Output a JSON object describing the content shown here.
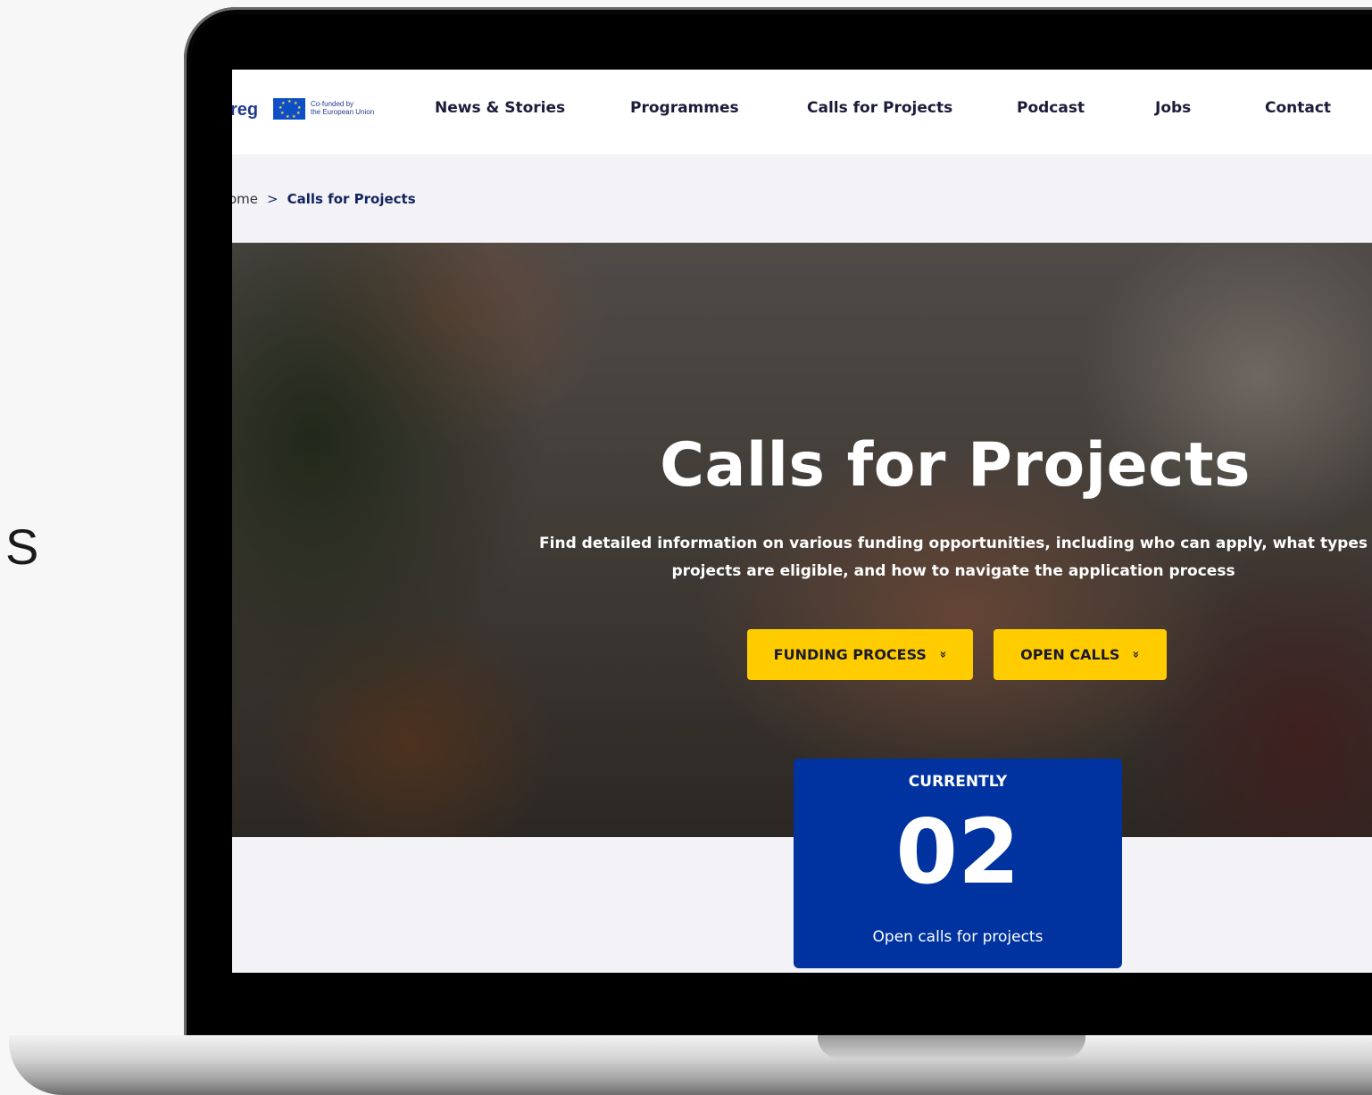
{
  "side_text": "S",
  "nav": {
    "logo_text": "reg",
    "eu_caption_line1": "Co-funded by",
    "eu_caption_line2": "the European Union",
    "items": [
      "News & Stories",
      "Programmes",
      "Calls for Projects",
      "Podcast",
      "Jobs",
      "Contact"
    ]
  },
  "breadcrumb": {
    "home": "ome",
    "separator": ">",
    "current": "Calls for Projects"
  },
  "hero": {
    "title": "Calls for Projects",
    "subtitle_line1": "Find detailed information on various funding opportunities, including who can apply, what types",
    "subtitle_line2": "projects are eligible, and how to navigate the application process",
    "buttons": [
      {
        "label": "FUNDING PROCESS",
        "icon": "double-chevron-down-icon"
      },
      {
        "label": "OPEN CALLS",
        "icon": "double-chevron-down-icon"
      }
    ]
  },
  "counter": {
    "label": "CURRENTLY",
    "number": "02",
    "caption": "Open calls for projects"
  },
  "colors": {
    "accent_yellow": "#ffcc00",
    "card_blue": "#0033a0",
    "nav_text": "#1c1c3a",
    "brand_blue": "#1f3b8f"
  }
}
